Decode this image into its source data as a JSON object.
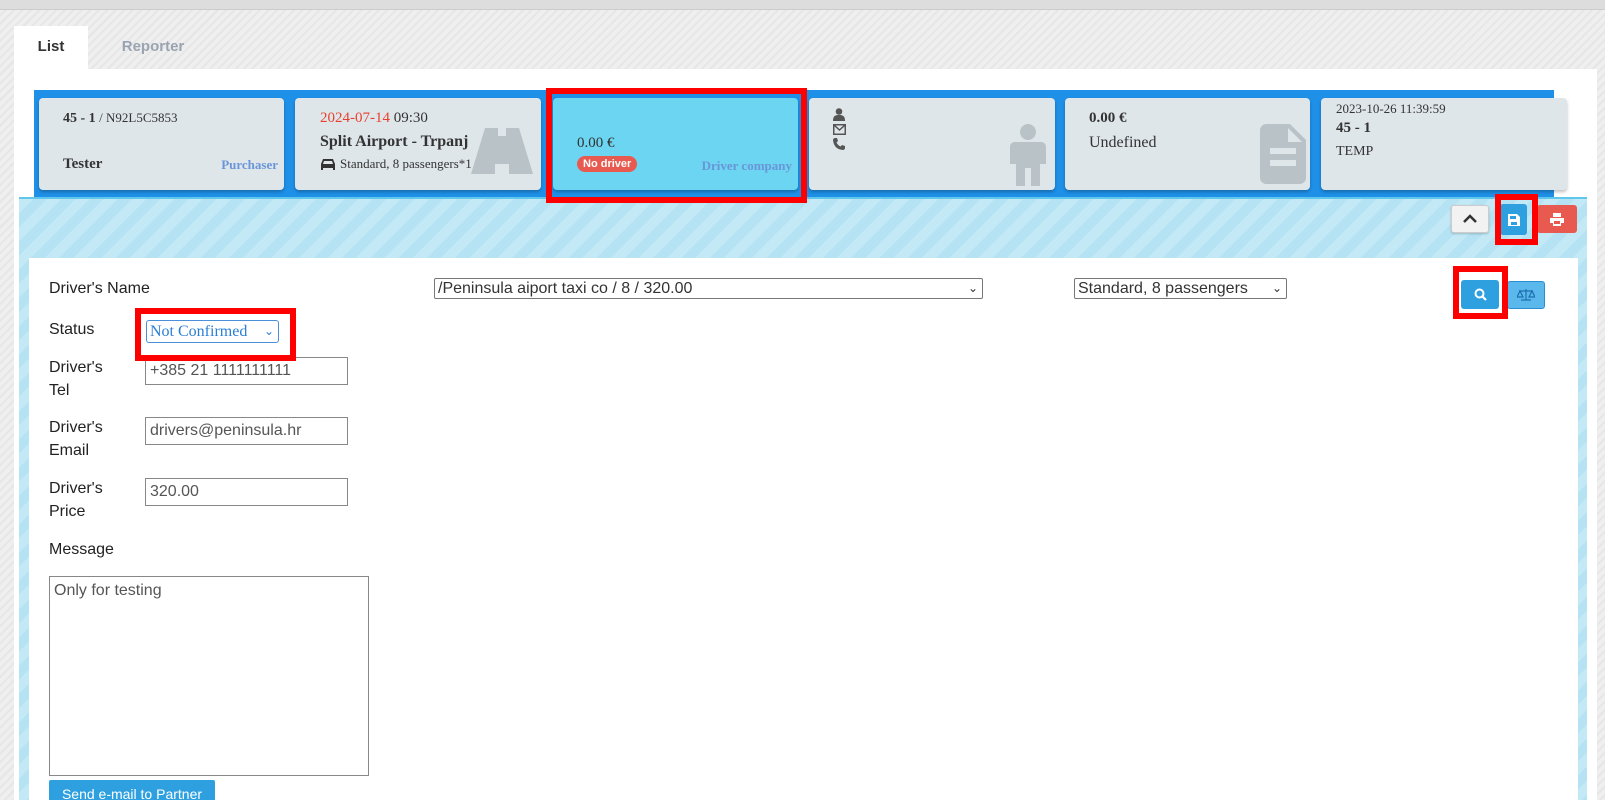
{
  "tabs": [
    {
      "label": "List"
    },
    {
      "label": "Reporter"
    }
  ],
  "cards": {
    "purchaser": {
      "id_bold": "45 - 1",
      "id_rest": "/ N92L5C5853",
      "name": "Tester",
      "role": "Purchaser"
    },
    "route": {
      "date": "2024-07-14",
      "time": "09:30",
      "title": "Split Airport - Trpanj",
      "vehicle": "Standard, 8 passengers*1"
    },
    "driver": {
      "price": "0.00 €",
      "badge": "No driver",
      "role": "Driver company"
    },
    "passenger": {},
    "invoice": {
      "price": "0.00 €",
      "status": "Undefined"
    },
    "meta": {
      "timestamp": "2023-10-26 11:39:59",
      "id": "45 - 1",
      "code": "TEMP"
    }
  },
  "form": {
    "drivers_name_label": "Driver's Name",
    "driver_select": "/Peninsula aiport taxi co / 8 / 320.00",
    "vehicle_select": "Standard, 8 passengers",
    "status_label": "Status",
    "status_value": "Not Confirmed",
    "tel_label_1": "Driver's",
    "tel_label_2": "Tel",
    "tel_value": "+385 21 1111111111",
    "email_label_1": "Driver's",
    "email_label_2": "Email",
    "email_value": "drivers@peninsula.hr",
    "price_label_1": "Driver's",
    "price_label_2": "Price",
    "price_value": "320.00",
    "message_label": "Message",
    "message_value": "Only for testing",
    "send_button": "Send e-mail to Partner"
  },
  "colors": {
    "accent": "#1e90e8",
    "driver_card": "#6cd5f1",
    "danger": "#e85a4f",
    "highlight": "#ff0000",
    "date": "#e8402e"
  }
}
